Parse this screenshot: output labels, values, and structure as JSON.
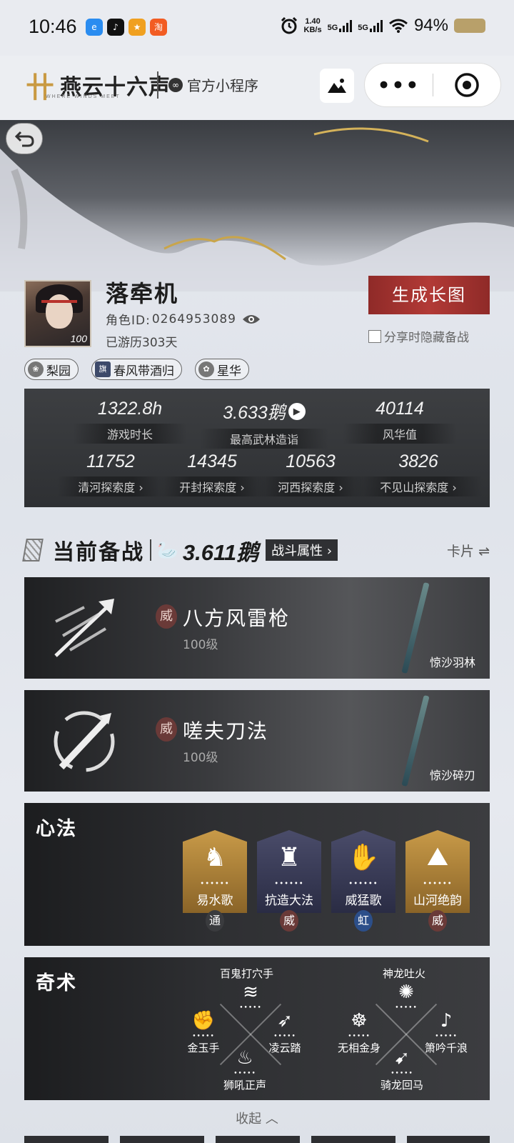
{
  "status_bar": {
    "time": "10:46",
    "apps": [
      {
        "icon": "browser-app-icon",
        "label": "e",
        "color": "#2a8cf0"
      },
      {
        "icon": "douyin-app-icon",
        "label": "♪",
        "color": "#111111"
      },
      {
        "icon": "game-app-icon",
        "label": "★",
        "color": "#f0a020"
      },
      {
        "icon": "taobao-app-icon",
        "label": "淘",
        "color": "#f25c23"
      }
    ],
    "speed_value": "1.40",
    "speed_unit": "KB/s",
    "sig1": "5G",
    "sig2": "5G",
    "battery": "94%"
  },
  "mini_program": {
    "logo_title": "燕云十六声",
    "logo_sub": "WHERE WINDS MEET",
    "official_label": "官方小程序"
  },
  "profile": {
    "name": "落牵机",
    "role_id_label": "角色ID:",
    "role_id": "0264953089",
    "days": "已游历303天",
    "level": "100",
    "generate_button": "生成长图",
    "hide_checkbox": "分享时隐藏备战",
    "tags": [
      {
        "icon": "pear-garden-icon",
        "label": "梨园"
      },
      {
        "icon": "guild-banner-icon",
        "label": "春风带酒归"
      },
      {
        "icon": "star-flower-icon",
        "label": "星华"
      }
    ]
  },
  "stats": {
    "row1": [
      {
        "value": "1322.8h",
        "label": "游戏时长"
      },
      {
        "value": "3.633鹅",
        "label": "最高武林造诣"
      },
      {
        "value": "40114",
        "label": "风华值"
      }
    ],
    "row2": [
      {
        "value": "11752",
        "label": "清河探索度"
      },
      {
        "value": "14345",
        "label": "开封探索度"
      },
      {
        "value": "10563",
        "label": "河西探索度"
      },
      {
        "value": "3826",
        "label": "不见山探索度"
      }
    ]
  },
  "battle": {
    "title": "当前备战",
    "score": "3.611鹅",
    "attr_button": "战斗属性",
    "card_toggle": "卡片 ⇌",
    "weapons": [
      {
        "badge": "威",
        "name": "八方风雷枪",
        "level": "100级",
        "sub": "惊沙羽林"
      },
      {
        "badge": "威",
        "name": "嗟夫刀法",
        "level": "100级",
        "sub": "惊沙碎刃"
      }
    ]
  },
  "xinfa": {
    "title": "心法",
    "items": [
      {
        "name": "易水歌",
        "badge": "通",
        "bg": "#b98b3a",
        "badge_color": "#3a3b3e",
        "glyph": "♞"
      },
      {
        "name": "抗造大法",
        "badge": "威",
        "bg": "#3a3d5a",
        "badge_color": "#6a3a38",
        "glyph": "♜"
      },
      {
        "name": "威猛歌",
        "badge": "虹",
        "bg": "#3a3d5a",
        "badge_color": "#2c4f8a",
        "glyph": "✋"
      },
      {
        "name": "山河绝韵",
        "badge": "威",
        "bg": "#b98b3a",
        "badge_color": "#6a3a38",
        "glyph": "⛰"
      }
    ],
    "dots": "••••••"
  },
  "qishu": {
    "title": "奇术",
    "group1_title": "百鬼打穴手",
    "group2_title": "神龙吐火",
    "group1": [
      {
        "name": "金玉手",
        "glyph": "✊"
      },
      {
        "name": "凌云踏",
        "glyph": "➶"
      },
      {
        "name": "狮吼正声",
        "glyph": "♨"
      }
    ],
    "group2": [
      {
        "name": "无相金身",
        "glyph": "☸"
      },
      {
        "name": "箫吟千浪",
        "glyph": "♪"
      },
      {
        "name": "骑龙回马",
        "glyph": "➹"
      }
    ],
    "top1_glyph": "≋",
    "top2_glyph": "✺",
    "dots": "•••••"
  },
  "collapse_label": "收起"
}
